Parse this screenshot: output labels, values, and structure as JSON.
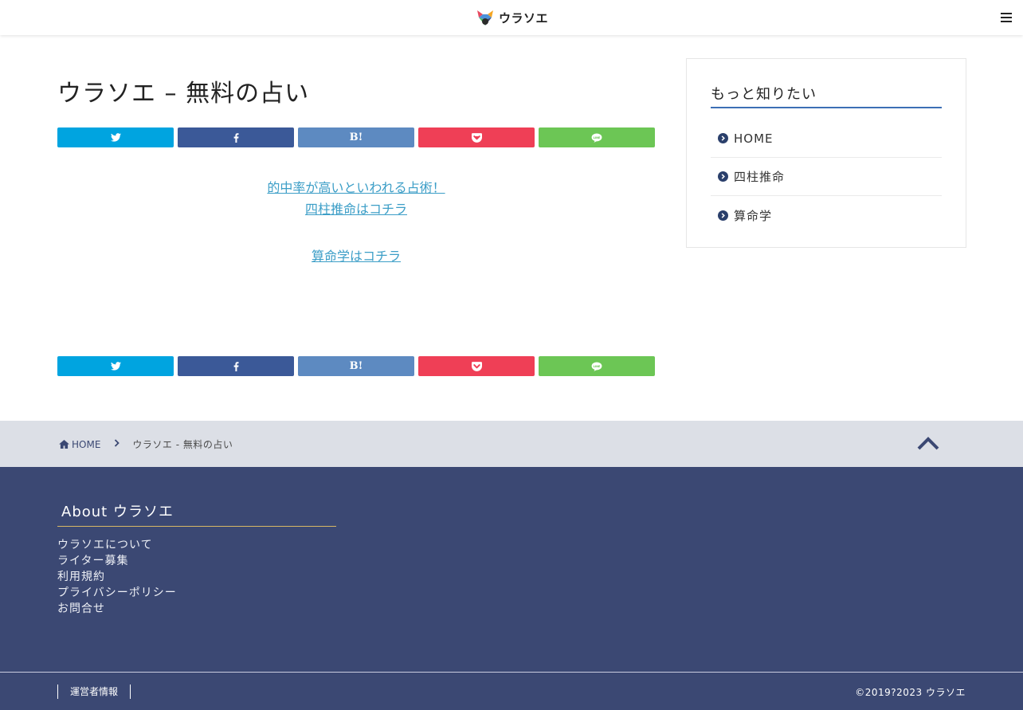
{
  "header": {
    "logo_text": "ウラソエ",
    "menu_icon": "hamburger-menu-icon"
  },
  "article": {
    "title": "ウラソエ – 無料の占い",
    "share_buttons": [
      {
        "name": "twitter",
        "icon": "twitter-icon",
        "label": "",
        "color": "#00a4e0"
      },
      {
        "name": "facebook",
        "icon": "facebook-icon",
        "label": "",
        "color": "#3b5998"
      },
      {
        "name": "hatena",
        "icon": "hatena-bookmark-icon",
        "label": "B!",
        "color": "#5d8ac1"
      },
      {
        "name": "pocket",
        "icon": "pocket-icon",
        "label": "",
        "color": "#ef3f56"
      },
      {
        "name": "line",
        "icon": "line-icon",
        "label": "",
        "color": "#6cc655"
      }
    ],
    "links": {
      "line1": "的中率が高いといわれる占術！",
      "line2": "四柱推命はコチラ",
      "line3": "算命学はコチラ"
    }
  },
  "sidebar": {
    "title": "もっと知りたい",
    "items": [
      {
        "label": "HOME"
      },
      {
        "label": "四柱推命"
      },
      {
        "label": "算命学"
      }
    ]
  },
  "breadcrumb": {
    "home": "HOME",
    "current": "ウラソエ - 無料の占い"
  },
  "footer": {
    "about_title": "About ウラソエ",
    "links": [
      "ウラソエについて",
      "ライター募集",
      "利用規約",
      "プライバシーポリシー",
      "お問合せ"
    ],
    "operator": "運営者情報",
    "copyright": "©2019?2023  ウラソエ"
  },
  "colors": {
    "accent": "#3b4873",
    "link": "#3c9ec7",
    "sidebar_underline": "#3c6fb5",
    "footer_underline": "#d7b765"
  }
}
